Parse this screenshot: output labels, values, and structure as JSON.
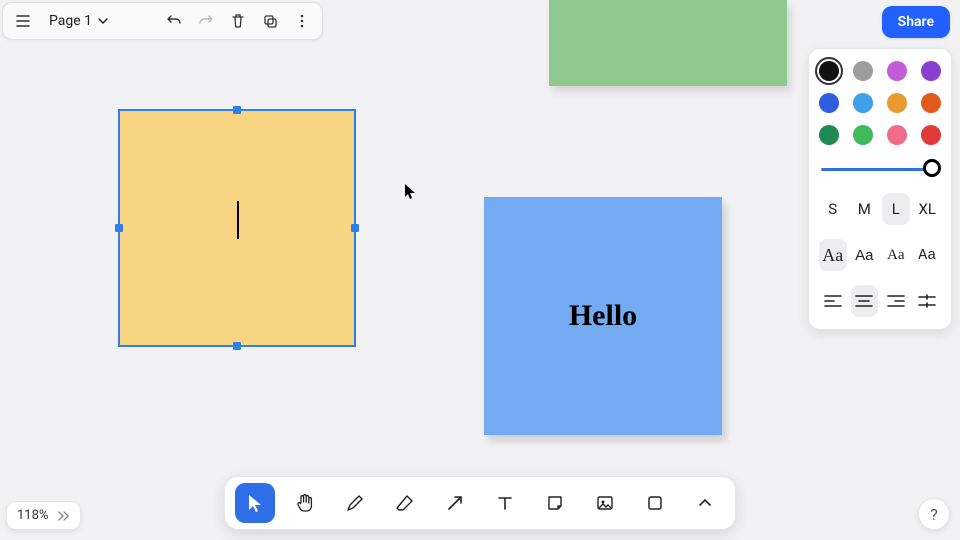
{
  "header": {
    "page_label": "Page 1"
  },
  "share_label": "Share",
  "zoom_label": "118%",
  "help_label": "?",
  "notes": {
    "yellow_text": "",
    "blue_text": "Hello",
    "green_text": ""
  },
  "style_panel": {
    "colors": [
      "#111111",
      "#9c9c9c",
      "#c15bd6",
      "#8a3fcf",
      "#2f5fe0",
      "#3ea0e8",
      "#e79a2f",
      "#e2591e",
      "#1f8a56",
      "#3fb95a",
      "#ef6b8a",
      "#e03a3a"
    ],
    "selected_color_index": 0,
    "slider_value": 100,
    "sizes": [
      "S",
      "M",
      "L",
      "XL"
    ],
    "selected_size_index": 2,
    "fonts": [
      "Aa",
      "Aa",
      "Aa",
      "Aa"
    ],
    "selected_font_index": 0,
    "selected_align_index": 1
  },
  "tools": {
    "items": [
      "select",
      "hand",
      "draw",
      "eraser",
      "arrow",
      "text",
      "note",
      "image",
      "shape",
      "more"
    ],
    "active_index": 0
  }
}
